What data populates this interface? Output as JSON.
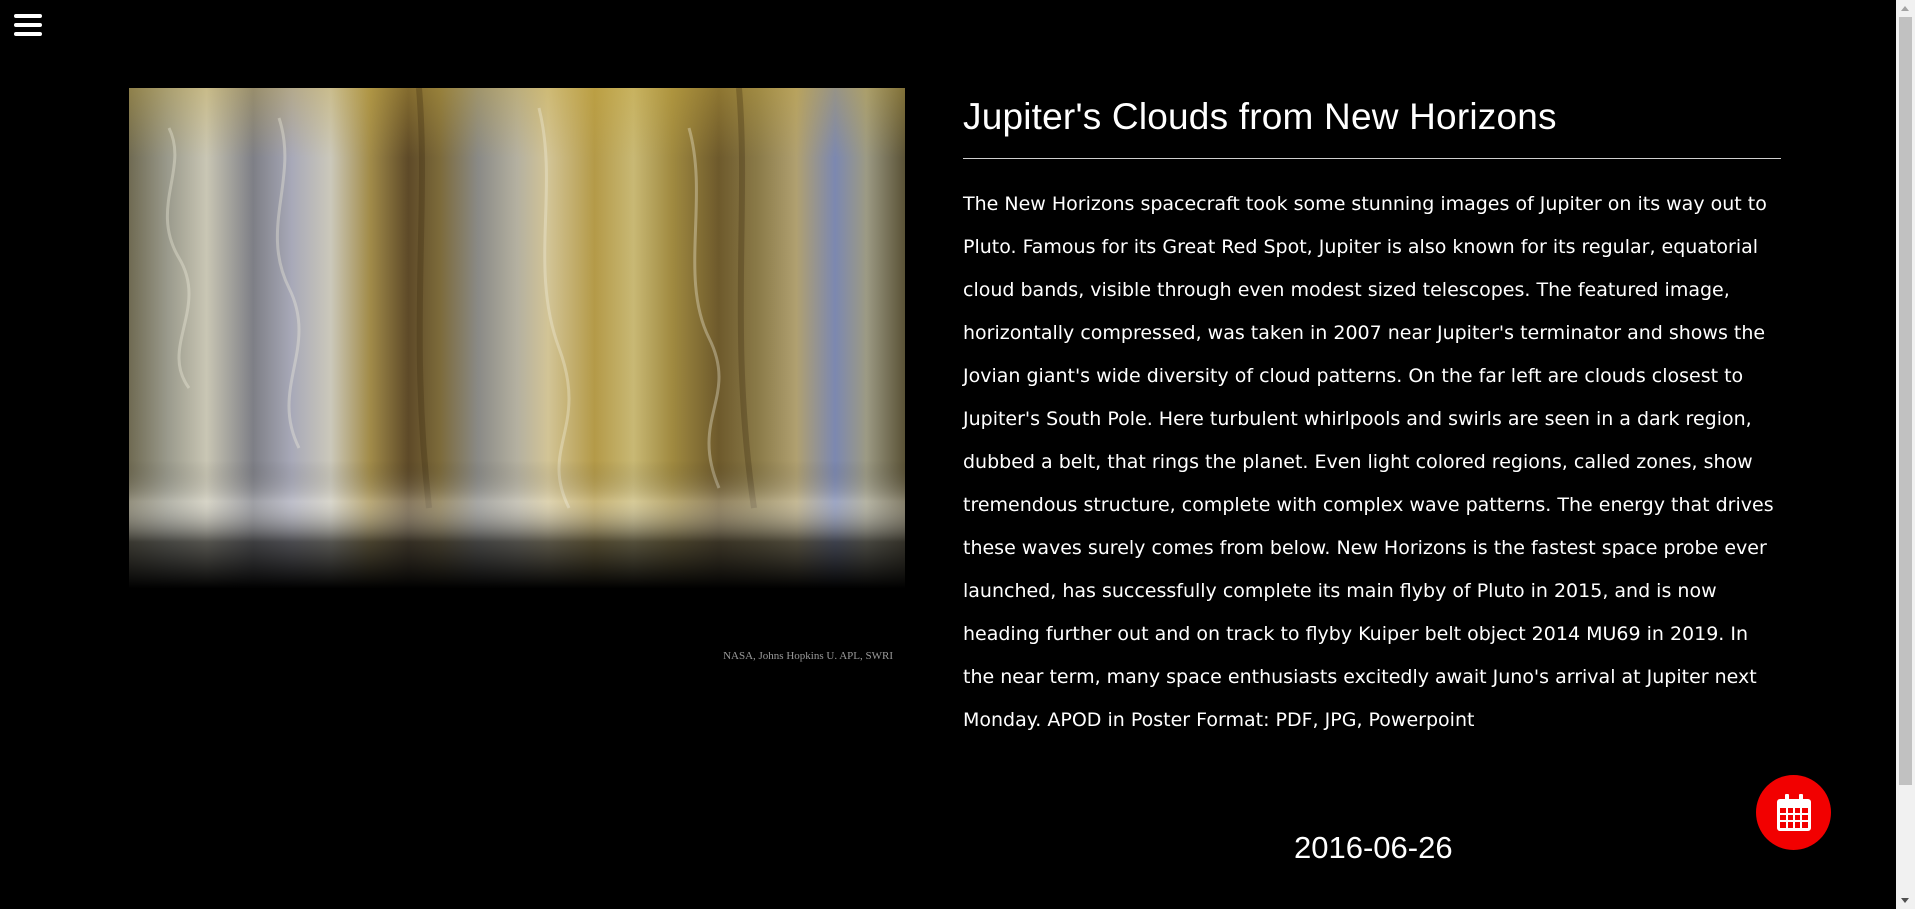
{
  "header": {
    "menu_icon": "hamburger-menu-icon"
  },
  "image": {
    "credit": "NASA, Johns Hopkins U. APL, SWRI"
  },
  "article": {
    "title": "Jupiter's Clouds from New Horizons",
    "description_pre": "The New Horizons spacecraft took some stunning images of Jupiter on its way out to Pluto. Famous for its Great Red Spot, Jupiter is also known for its regular, equatorial cloud bands, visible through even modest sized telescopes. The featured image, horizontally compressed, was taken in 2007 near Jupiter's terminator and shows the Jovian giant's wide diversity of cloud patterns. On the far left are clouds closest to Jupiter's South Pole. Here turbulent whirlpools and swirls are seen in a dark region, dubbed a belt, that rings the planet. Even light colored regions, called zones, show tremendous structure, complete with complex wave patterns. The energy that drives these waves surely comes from below. New Horizons is the fastest space probe ever launched, has successfully complete its main flyby of Pluto in 2015, and is now heading further out and on track to flyby Kuiper belt object 2014 MU69 in 2019. In the near term, many space enthusiasts excitedly await Juno's arrival at Jupiter next Monday. APOD in Poster Format: ",
    "poster_links": [
      {
        "label": "PDF",
        "sep": ", "
      },
      {
        "label": "JPG",
        "sep": ", "
      },
      {
        "label": "Powerpoint",
        "sep": ""
      }
    ],
    "date": "2016-06-26"
  },
  "calendar_button": {
    "icon": "calendar-icon",
    "color": "#f20000"
  }
}
